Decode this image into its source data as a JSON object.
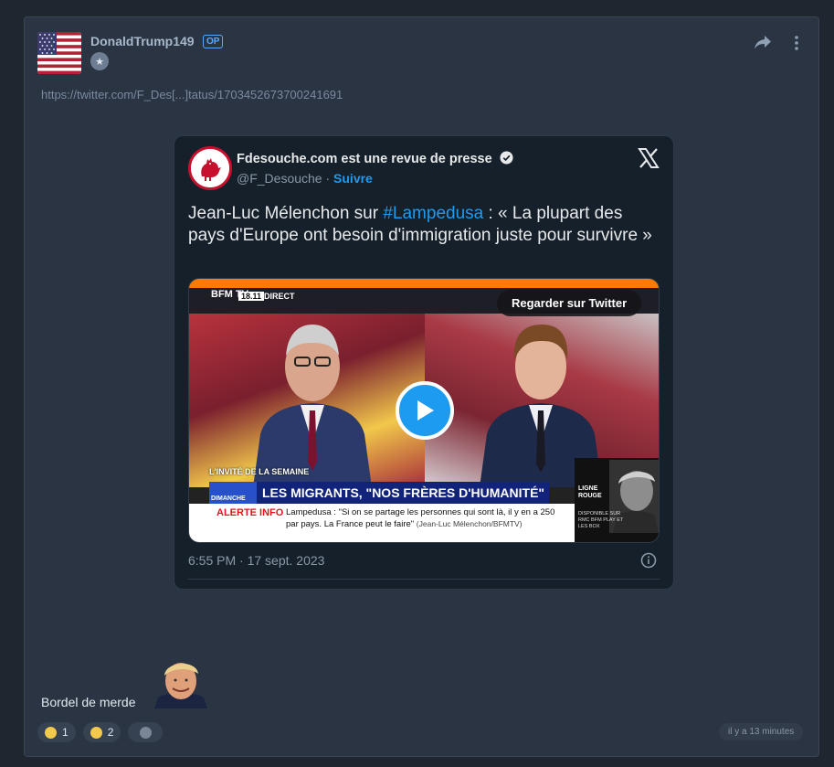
{
  "post": {
    "username": "DonaldTrump149",
    "op_badge": "OP",
    "link": "https://twitter.com/F_Des[...]tatus/1703452673700241691",
    "comment": "Bordel de merde",
    "timestamp": "il y a 13 minutes"
  },
  "tweet": {
    "account_name": "Fdesouche.com est une revue de presse",
    "handle": "@F_Desouche",
    "separator": " · ",
    "follow_label": "Suivre",
    "text_before": "Jean-Luc Mélenchon sur ",
    "hashtag": "#Lampedusa",
    "text_after": " : « La plupart des pays d'Europe ont besoin d'immigration juste pour survivre »",
    "date": "6:55 PM · 17 sept. 2023",
    "watch_label": "Regarder sur Twitter"
  },
  "video": {
    "channel": "BFM TV",
    "time": "18.11",
    "live": "DIRECT",
    "guest_label": "L'INVITÉ DE LA SEMAINE",
    "show": "DIMANCHE",
    "headline": "LES MIGRANTS, \"NOS FRÈRES D'HUMANITÉ\"",
    "alert_label": "ALERTE INFO",
    "alert_text": "Lampedusa : \"Si on se partage les personnes qui sont là, il y en a 250 par pays. La France peut le faire\"",
    "alert_source": "(Jean-Luc Mélenchon/BFMTV)",
    "promo_title": "LIGNE ROUGE",
    "promo_text": "DISPONIBLE SUR RMC BFM PLAY ET LES BOX"
  },
  "reactions": [
    {
      "count": "1",
      "icon": "joy-emoji"
    },
    {
      "count": "2",
      "icon": "sad-emoji"
    }
  ],
  "colors": {
    "accent": "#1d9bf0",
    "op": "#5aa9ff",
    "card_bg": "#2a3442",
    "tweet_bg": "#15202b"
  }
}
